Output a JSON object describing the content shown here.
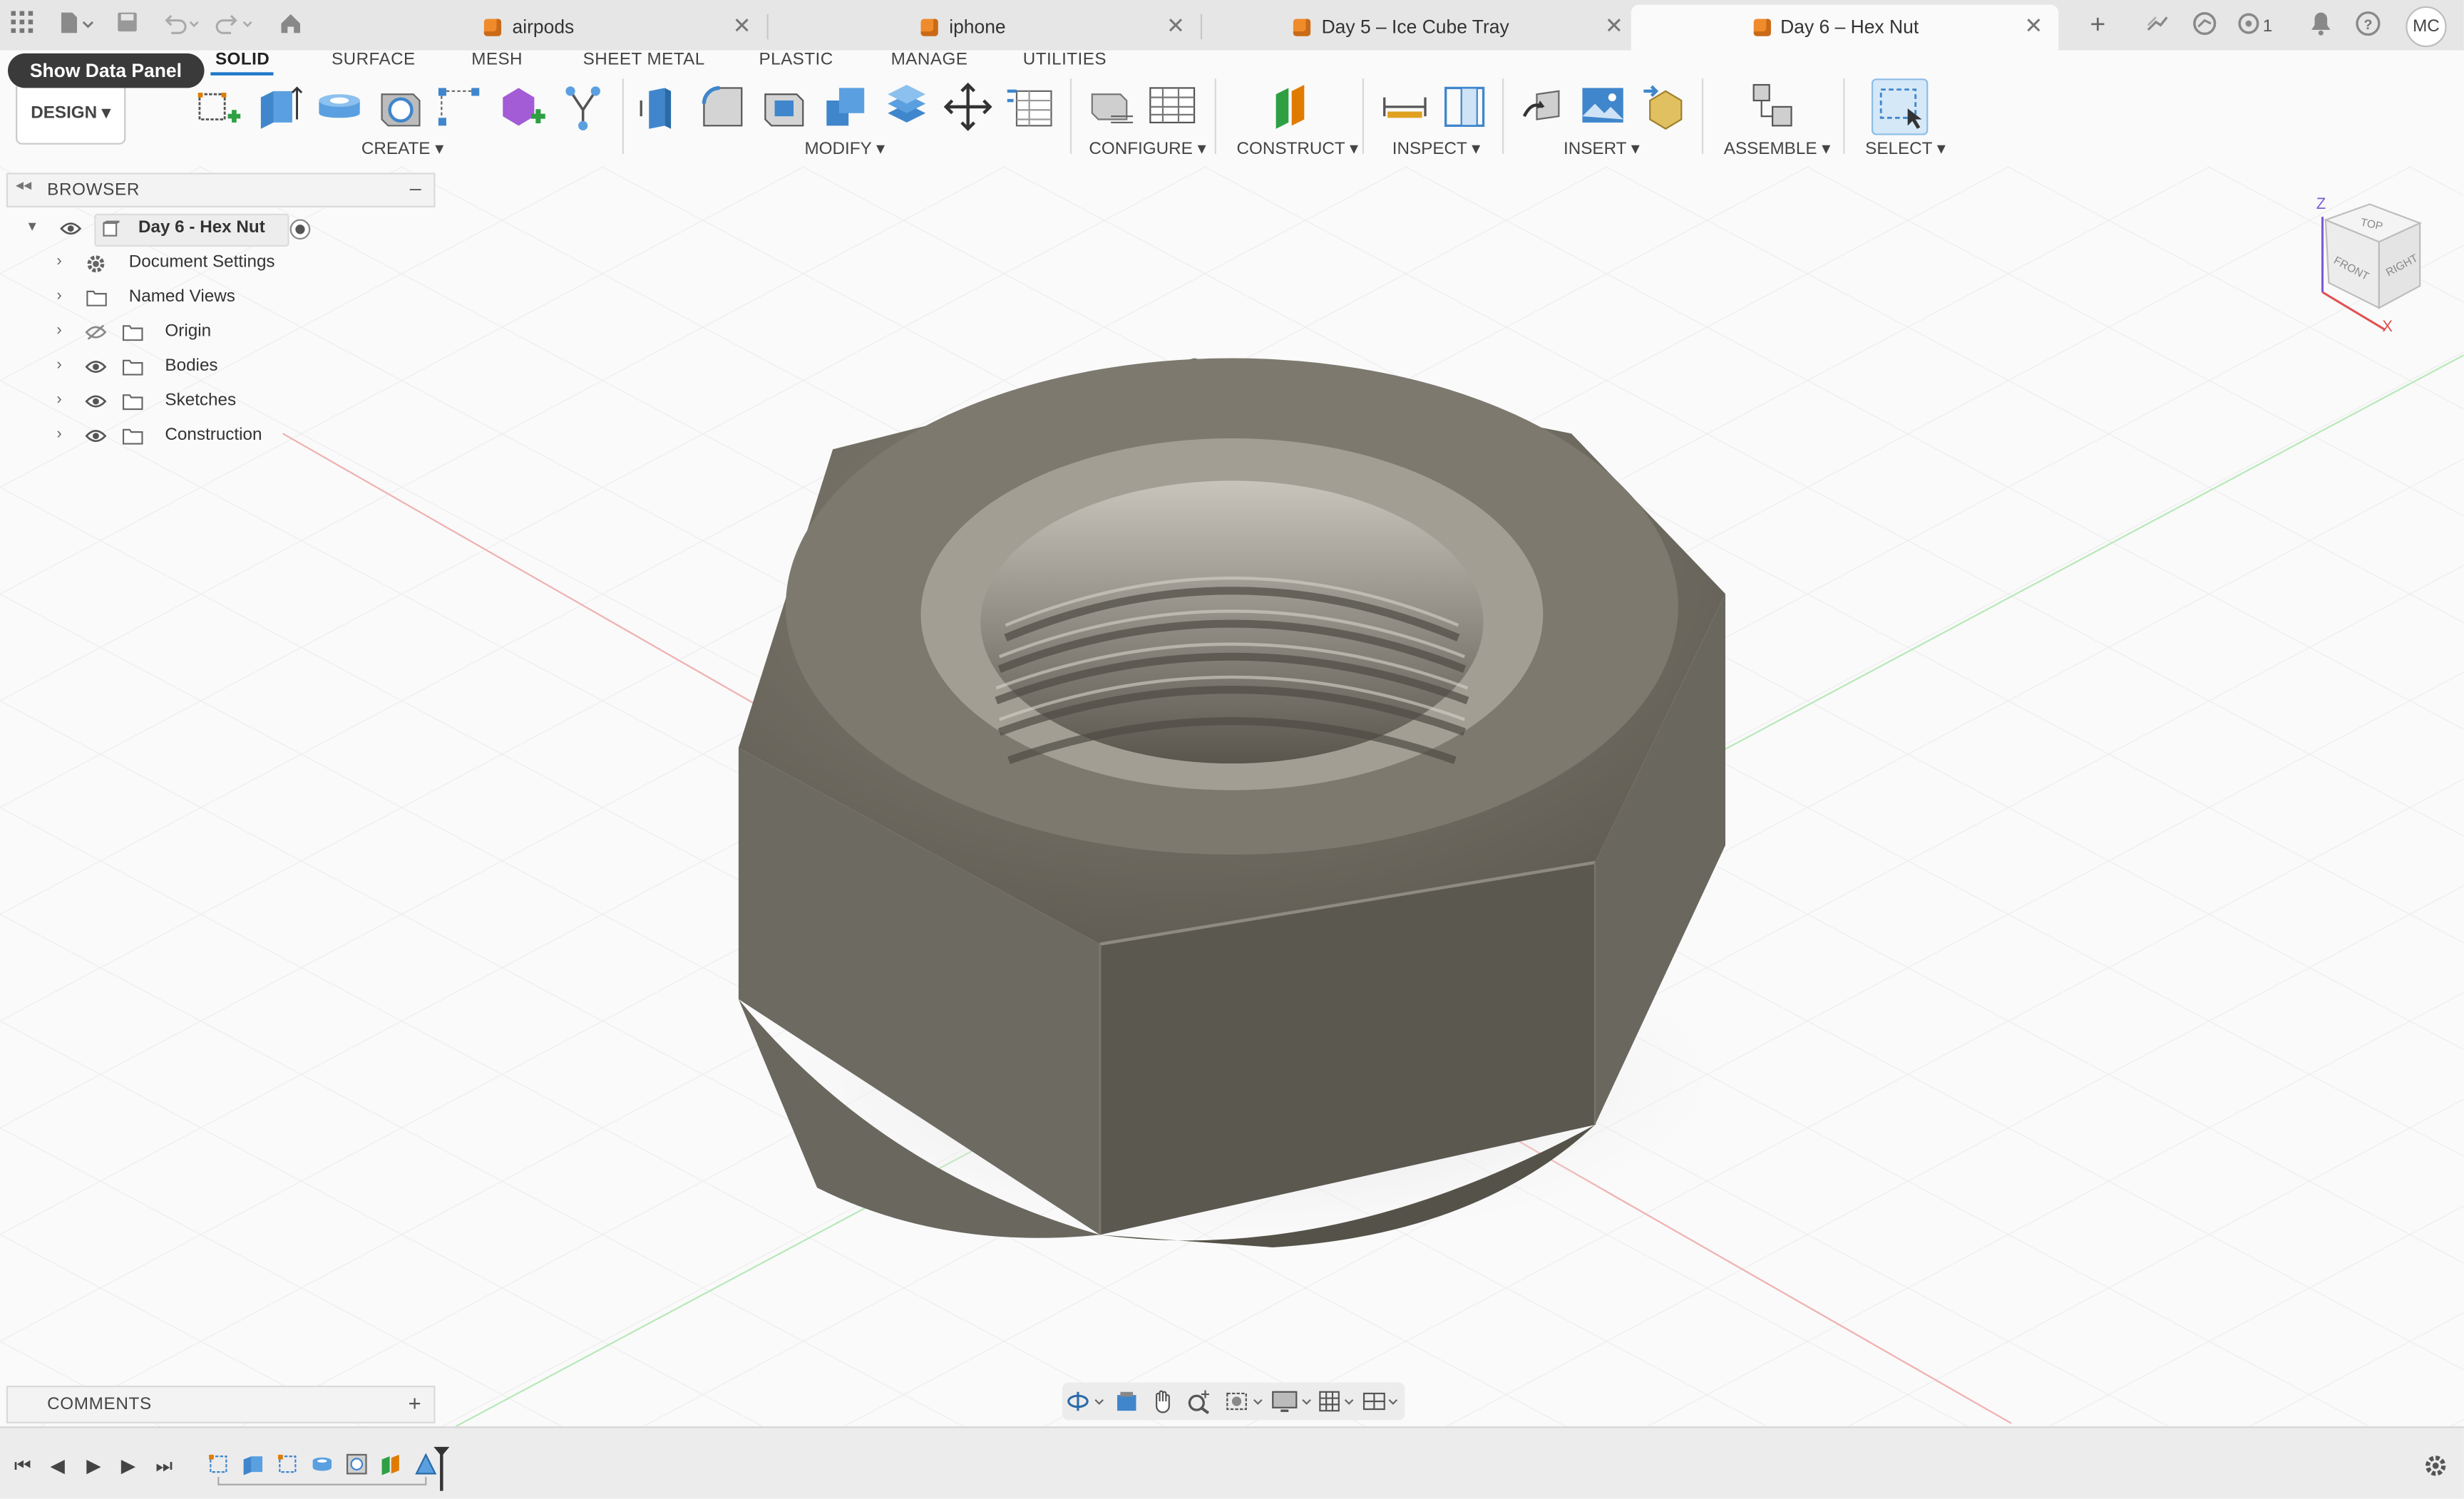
{
  "tabs": [
    {
      "label": "airpods",
      "active": false
    },
    {
      "label": "iphone",
      "active": false
    },
    {
      "label": "Day 5 – Ice Cube Tray",
      "active": false
    },
    {
      "label": "Day 6 – Hex Nut",
      "active": true
    }
  ],
  "topbar": {
    "job_count": "1",
    "user_initials": "MC"
  },
  "workspace_tabs": [
    "SOLID",
    "SURFACE",
    "MESH",
    "SHEET METAL",
    "PLASTIC",
    "MANAGE",
    "UTILITIES"
  ],
  "active_workspace": "SOLID",
  "design_button": "DESIGN ▾",
  "tooltip": "Show Data Panel",
  "toolbar_groups": [
    "CREATE ▾",
    "MODIFY ▾",
    "CONFIGURE ▾",
    "CONSTRUCT ▾",
    "INSPECT ▾",
    "INSERT ▾",
    "ASSEMBLE ▾",
    "SELECT ▾"
  ],
  "browser": {
    "title": "BROWSER",
    "root": "Day 6 - Hex Nut",
    "items": [
      {
        "label": "Document Settings",
        "icon": "gear-icon",
        "visibility": "none"
      },
      {
        "label": "Named Views",
        "icon": "folder-icon",
        "visibility": "none"
      },
      {
        "label": "Origin",
        "icon": "folder-icon",
        "visibility": "hidden"
      },
      {
        "label": "Bodies",
        "icon": "folder-icon",
        "visibility": "visible"
      },
      {
        "label": "Sketches",
        "icon": "folder-icon",
        "visibility": "visible"
      },
      {
        "label": "Construction",
        "icon": "folder-icon",
        "visibility": "visible"
      }
    ]
  },
  "comments": {
    "title": "COMMENTS"
  },
  "viewcube": {
    "top": "TOP",
    "front": "FRONT",
    "right": "RIGHT",
    "axis_z": "Z",
    "axis_x": "X"
  },
  "colors": {
    "accent": "#1e78c8",
    "tab_cube": "#f08b2c",
    "nut_body": "#6e6a60",
    "axis_red": "#e07070",
    "axis_green": "#7fd27f"
  }
}
